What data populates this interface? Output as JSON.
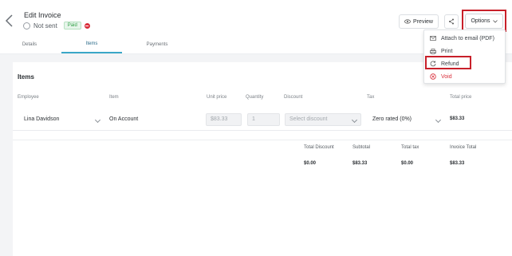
{
  "header": {
    "title": "Edit Invoice",
    "status": "Not sent",
    "paid_badge": "Paid",
    "preview_label": "Preview",
    "options_label": "Options"
  },
  "tabs": [
    {
      "label": "Details",
      "active": false
    },
    {
      "label": "Items",
      "active": true
    },
    {
      "label": "Payments",
      "active": false
    }
  ],
  "items_section": {
    "heading": "Items",
    "columns": {
      "employee": "Employee",
      "item": "Item",
      "unit_price": "Unit price",
      "quantity": "Quantity",
      "discount": "Discount",
      "tax": "Tax",
      "total_price": "Total price"
    },
    "row": {
      "employee": "Lina Davidson",
      "item": "On Account",
      "unit_price": "$83.33",
      "quantity": "1",
      "discount_placeholder": "Select discount",
      "tax": "Zero rated (0%)",
      "total_price": "$83.33"
    }
  },
  "totals": {
    "headers": {
      "total_discount": "Total Discount",
      "subtotal": "Subtotal",
      "total_tax": "Total tax",
      "invoice_total": "Invoice Total"
    },
    "values": {
      "total_discount": "$0.00",
      "subtotal": "$83.33",
      "total_tax": "$0.00",
      "invoice_total": "$83.33"
    }
  },
  "options_menu": {
    "items": [
      {
        "label": "Attach to email (PDF)",
        "icon": "email-icon"
      },
      {
        "label": "Print",
        "icon": "print-icon"
      },
      {
        "label": "Refund",
        "icon": "refund-icon"
      },
      {
        "label": "Void",
        "icon": "void-icon"
      }
    ]
  },
  "colors": {
    "accent": "#3aa7c7",
    "highlight": "#c8202a",
    "void": "#d9303c",
    "paid": "#2f9e44"
  }
}
